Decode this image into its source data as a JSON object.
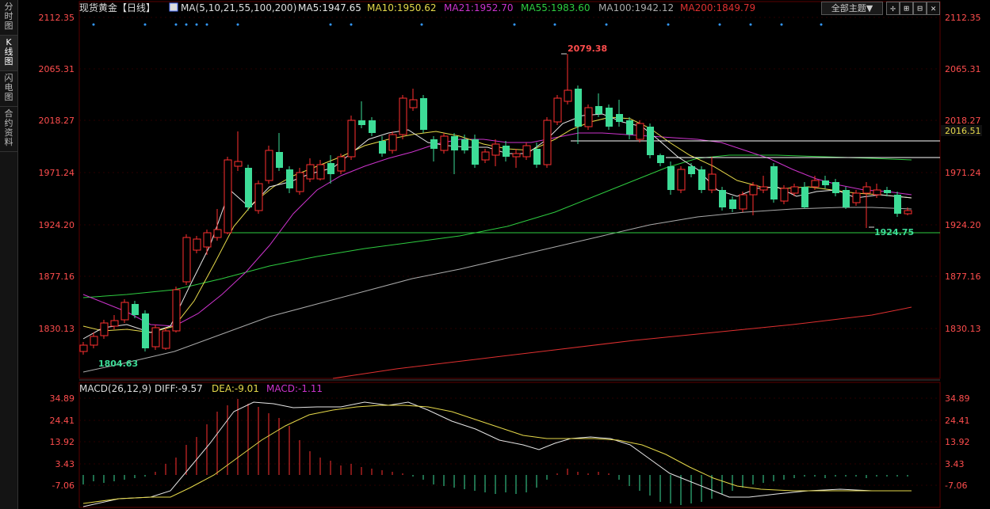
{
  "sidebar": {
    "items": [
      {
        "label": "分时图",
        "chars": [
          "分",
          "时",
          "图"
        ]
      },
      {
        "label": "K线图",
        "chars": [
          "K",
          "线",
          "图"
        ]
      },
      {
        "label": "闪电图",
        "chars": [
          "闪",
          "电",
          "图"
        ]
      },
      {
        "label": "合约资料",
        "chars": [
          "合",
          "约",
          "资",
          "料"
        ]
      }
    ]
  },
  "header": {
    "title": "现货黄金【日线】",
    "ma_params": "MA(5,10,21,55,100,200)",
    "ma5": "MA5:1947.65",
    "ma10": "MA10:1950.62",
    "ma21": "MA21:1952.70",
    "ma55": "MA55:1983.60",
    "ma100": "MA100:1942.12",
    "ma200": "MA200:1849.79",
    "theme_select": "全部主题▼",
    "tool_icons": [
      "crosshair-icon",
      "zoom-in-icon",
      "zoom-out-icon",
      "close-icon"
    ],
    "tool_glyphs": [
      "✢",
      "⊞",
      "⊟",
      "✕"
    ]
  },
  "colors": {
    "bg": "#000000",
    "up": "#ff3030",
    "down": "#3ddc97",
    "ma5": "#e6e6e6",
    "ma10": "#e6d94a",
    "ma21": "#cc33cc",
    "ma55": "#2ecc40",
    "ma100": "#aaaaaa",
    "ma200": "#e03030",
    "axis_text": "#ff4d4d",
    "grid": "#3a0000"
  },
  "price_axis": {
    "ticks": [
      "2112.35",
      "2065.31",
      "2018.27",
      "1971.24",
      "1924.20",
      "1877.16",
      "1830.13"
    ],
    "values": [
      2112.35,
      2065.31,
      2018.27,
      1971.24,
      1924.2,
      1877.16,
      1830.13
    ]
  },
  "annotations": {
    "high_label": "2079.38",
    "low_label_left": "1804.63",
    "low_label_right": "1924.75",
    "hline_label": "2016.51"
  },
  "macd": {
    "header": "MACD(26,12,9)",
    "diff": "DIFF:-9.57",
    "dea": "DEA:-9.01",
    "macd": "MACD:-1.11",
    "ticks": [
      "34.89",
      "24.41",
      "13.92",
      "3.43",
      "-7.06"
    ],
    "values": [
      34.89,
      24.41,
      13.92,
      3.43,
      -7.06
    ]
  }
}
